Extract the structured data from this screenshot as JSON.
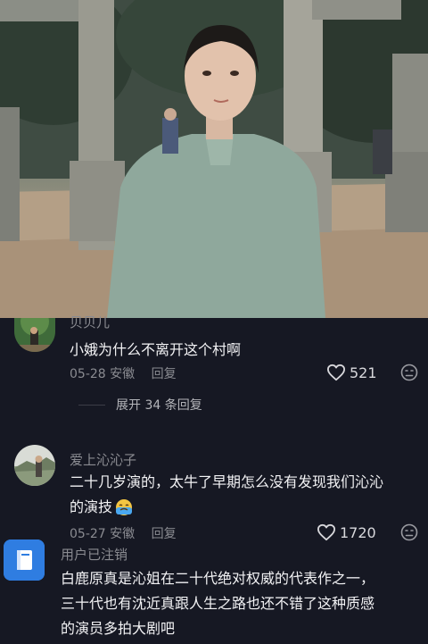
{
  "comments": [
    {
      "username": "贝贝儿",
      "text": "小娥为什么不离开这个村啊",
      "date": "05-28",
      "location": "安徽",
      "reply_label": "回复",
      "likes": "521",
      "replies_expand": "展开 34 条回复"
    },
    {
      "username": "爱上沁沁子",
      "text_line1": "二十几岁演的，太牛了早期怎么没有发现我们沁沁",
      "text_line2": "的演技",
      "date": "05-27",
      "location": "安徽",
      "reply_label": "回复",
      "likes": "1720"
    },
    {
      "username": "用户已注销",
      "text_line1": "白鹿原真是沁姐在二十代绝对权威的代表作之一，",
      "text_line2": "三十代也有沈近真跟人生之路也还不错了这种质感",
      "text_line3": "的演员多拍大剧吧"
    }
  ],
  "icons": {
    "like": "heart-icon",
    "dislike": "dislike-face-icon",
    "emoji": "crying-emoji-icon",
    "default_avatar": "book-avatar-icon"
  },
  "colors": {
    "background": "#161823",
    "muted_text": "#8a8b91",
    "primary_text": "#f2f2f4",
    "default_avatar_bg": "#2f7de1"
  }
}
